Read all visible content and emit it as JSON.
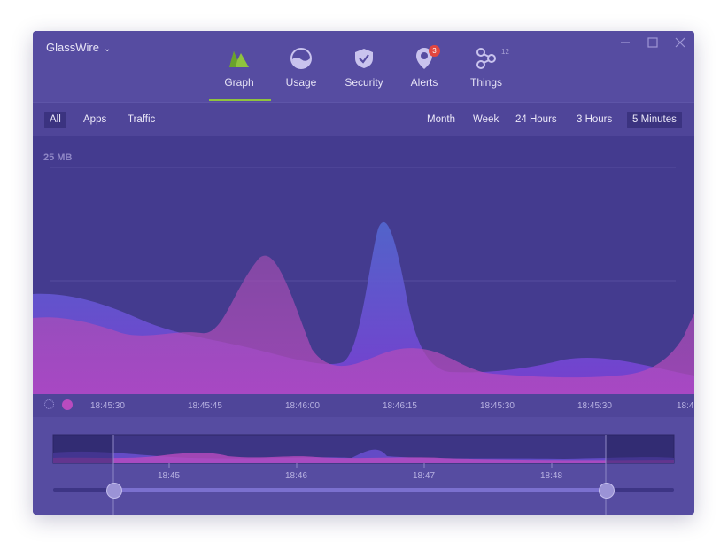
{
  "app": {
    "title": "GlassWire"
  },
  "nav": {
    "items": [
      {
        "label": "Graph",
        "icon": "graph-icon",
        "active": true
      },
      {
        "label": "Usage",
        "icon": "usage-icon"
      },
      {
        "label": "Security",
        "icon": "shield-icon"
      },
      {
        "label": "Alerts",
        "icon": "alerts-icon",
        "badge": "3"
      },
      {
        "label": "Things",
        "icon": "things-icon",
        "count": "12"
      }
    ]
  },
  "filters": {
    "left": [
      "All",
      "Apps",
      "Traffic"
    ],
    "active_left": "All",
    "right": [
      "Month",
      "Week",
      "24  Hours",
      "3  Hours",
      "5 Minutes"
    ],
    "active_right": "5 Minutes"
  },
  "graph": {
    "scale_label": "25 MB",
    "time_ticks": [
      "18:45:30",
      "18:45:45",
      "18:46:00",
      "18:46:15",
      "18:45:30",
      "18:45:30",
      "18:4"
    ]
  },
  "overview": {
    "ticks": [
      "18:45",
      "18:46",
      "18:47",
      "18:48"
    ],
    "selection_start": 0.1,
    "selection_end": 0.89
  },
  "colors": {
    "accent": "#8fc33d",
    "background": "#443b8f",
    "incoming": "#7d45d8",
    "outgoing": "#b94bbf",
    "badge": "#e2463f"
  }
}
